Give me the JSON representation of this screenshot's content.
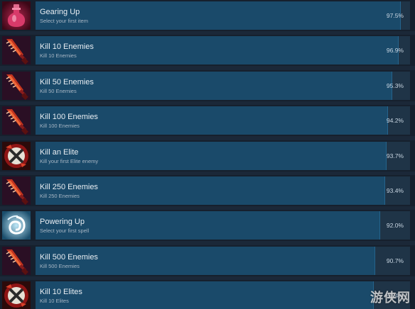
{
  "achievements": [
    {
      "title": "Gearing Up",
      "description": "Select your first item",
      "percent_text": "97.5%",
      "percent": 97.5,
      "icon": "potion-flask-icon"
    },
    {
      "title": "Kill 10 Enemies",
      "description": "Kill 10 Enemies",
      "percent_text": "96.9%",
      "percent": 96.9,
      "icon": "red-sword-icon"
    },
    {
      "title": "Kill 50 Enemies",
      "description": "Kill 50 Enemies",
      "percent_text": "95.3%",
      "percent": 95.3,
      "icon": "red-sword-icon"
    },
    {
      "title": "Kill 100 Enemies",
      "description": "Kill 100 Enemies",
      "percent_text": "94.2%",
      "percent": 94.2,
      "icon": "red-sword-icon"
    },
    {
      "title": "Kill an Elite",
      "description": "Kill your first Elite enemy",
      "percent_text": "93.7%",
      "percent": 93.7,
      "icon": "elite-sword-icon"
    },
    {
      "title": "Kill 250 Enemies",
      "description": "Kill 250 Enemies",
      "percent_text": "93.4%",
      "percent": 93.4,
      "icon": "red-sword-icon"
    },
    {
      "title": "Powering Up",
      "description": "Select your first spell",
      "percent_text": "92.0%",
      "percent": 92.0,
      "icon": "swirl-spell-icon"
    },
    {
      "title": "Kill 500 Enemies",
      "description": "Kill 500 Enemies",
      "percent_text": "90.7%",
      "percent": 90.7,
      "icon": "red-sword-icon"
    },
    {
      "title": "Kill 10 Elites",
      "description": "Kill 10 Elites",
      "percent_text": "90.4%",
      "percent": 90.4,
      "icon": "elite-sword-icon"
    }
  ],
  "watermark": "游侠网",
  "colors": {
    "background": "#1b2838",
    "bar_fill": "#1a4a6a",
    "bar_track": "#1f3447",
    "title_text": "#e9eef3",
    "desc_text": "#a7b6c4"
  }
}
